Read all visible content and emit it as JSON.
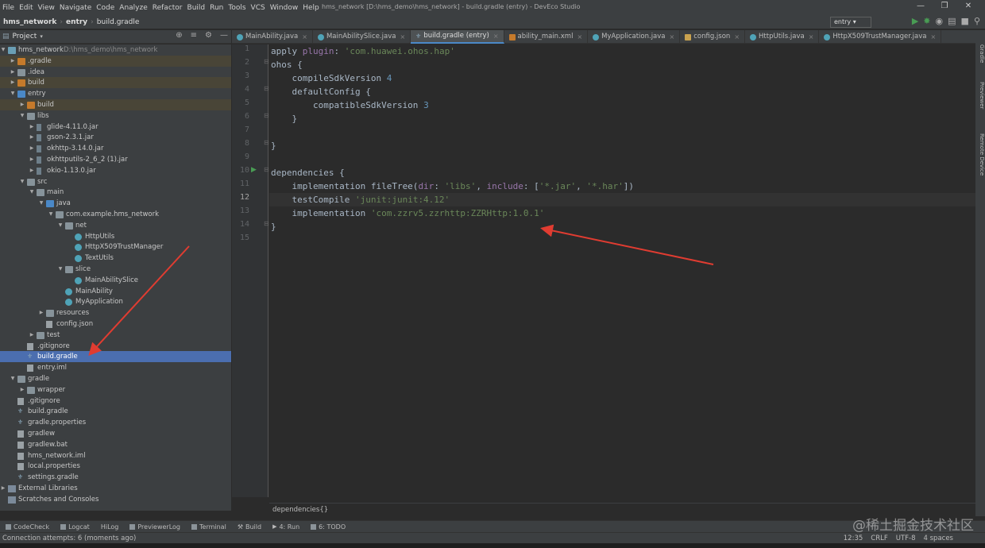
{
  "menu": [
    "File",
    "Edit",
    "View",
    "Navigate",
    "Code",
    "Analyze",
    "Refactor",
    "Build",
    "Run",
    "Tools",
    "VCS",
    "Window",
    "Help"
  ],
  "window_title": "hms_network [D:\\hms_demo\\hms_network] - build.gradle (entry) - DevEco Studio",
  "navbar": {
    "project": "hms_network",
    "module": "entry",
    "file": "build.gradle"
  },
  "run_config": "entry",
  "project_panel": {
    "title": "Project"
  },
  "tree": [
    {
      "label": "hms_network",
      "path": "D:\\hms_demo\\hms_network"
    },
    {
      "label": ".gradle"
    },
    {
      "label": ".idea"
    },
    {
      "label": "build"
    },
    {
      "label": "entry"
    },
    {
      "label": "build"
    },
    {
      "label": "libs"
    },
    {
      "label": "glide-4.11.0.jar"
    },
    {
      "label": "gson-2.3.1.jar"
    },
    {
      "label": "okhttp-3.14.0.jar"
    },
    {
      "label": "okhttputils-2_6_2 (1).jar"
    },
    {
      "label": "okio-1.13.0.jar"
    },
    {
      "label": "src"
    },
    {
      "label": "main"
    },
    {
      "label": "java"
    },
    {
      "label": "com.example.hms_network"
    },
    {
      "label": "net"
    },
    {
      "label": "HttpUtils"
    },
    {
      "label": "HttpX509TrustManager"
    },
    {
      "label": "TextUtils"
    },
    {
      "label": "slice"
    },
    {
      "label": "MainAbilitySlice"
    },
    {
      "label": "MainAbility"
    },
    {
      "label": "MyApplication"
    },
    {
      "label": "resources"
    },
    {
      "label": "config.json"
    },
    {
      "label": "test"
    },
    {
      "label": ".gitignore"
    },
    {
      "label": "build.gradle"
    },
    {
      "label": "entry.iml"
    },
    {
      "label": "gradle"
    },
    {
      "label": "wrapper"
    },
    {
      "label": ".gitignore"
    },
    {
      "label": "build.gradle"
    },
    {
      "label": "gradle.properties"
    },
    {
      "label": "gradlew"
    },
    {
      "label": "gradlew.bat"
    },
    {
      "label": "hms_network.iml"
    },
    {
      "label": "local.properties"
    },
    {
      "label": "settings.gradle"
    },
    {
      "label": "External Libraries"
    },
    {
      "label": "Scratches and Consoles"
    }
  ],
  "tabs": [
    "MainAbility.java",
    "MainAbilitySlice.java",
    "build.gradle (entry)",
    "ability_main.xml",
    "MyApplication.java",
    "config.json",
    "HttpUtils.java",
    "HttpX509TrustManager.java"
  ],
  "line_numbers": [
    "1",
    "2",
    "3",
    "4",
    "5",
    "6",
    "7",
    "8",
    "9",
    "10",
    "11",
    "12",
    "13",
    "14",
    "15"
  ],
  "code": {
    "l1_a": "apply ",
    "l1_b": "plugin",
    "l1_c": ": ",
    "l1_d": "'com.huawei.ohos.hap'",
    "l2": "ohos {",
    "l3_a": "    compileSdkVersion ",
    "l3_b": "4",
    "l4": "    defaultConfig {",
    "l5_a": "        compatibleSdkVersion ",
    "l5_b": "3",
    "l6": "    }",
    "l8": "}",
    "l10": "dependencies {",
    "l11_a": "    implementation fileTree(",
    "l11_b": "dir",
    "l11_c": ": ",
    "l11_d": "'libs'",
    "l11_e": ", ",
    "l11_f": "include",
    "l11_g": ": [",
    "l11_h": "'*.jar'",
    "l11_i": ", ",
    "l11_j": "'*.har'",
    "l11_k": "])",
    "l12_a": "    testCompile ",
    "l12_b": "'junit:junit:4.12'",
    "l13_a": "    implementation ",
    "l13_b": "'com.zzrv5.zzrhttp:ZZRHttp:1.0.1'",
    "l14": "}"
  },
  "editor_breadcrumb": "dependencies{}",
  "right_tools": [
    "Gradle",
    "Previewer",
    "Remote Device"
  ],
  "bottom_tools": [
    "CodeCheck",
    "Logcat",
    "HiLog",
    "PreviewerLog",
    "Terminal",
    "Build",
    "4: Run",
    "6: TODO"
  ],
  "status": {
    "message": "Connection attempts: 6 (moments ago)",
    "position": "12:35",
    "line_sep": "CRLF",
    "encoding": "UTF-8",
    "indent": "4 spaces"
  },
  "watermark": "@稀土掘金技术社区",
  "colors": {
    "selection": "#4b6eaf",
    "string": "#6a8759",
    "number": "#6897bb",
    "annotation_arrow": "#e03c31"
  }
}
